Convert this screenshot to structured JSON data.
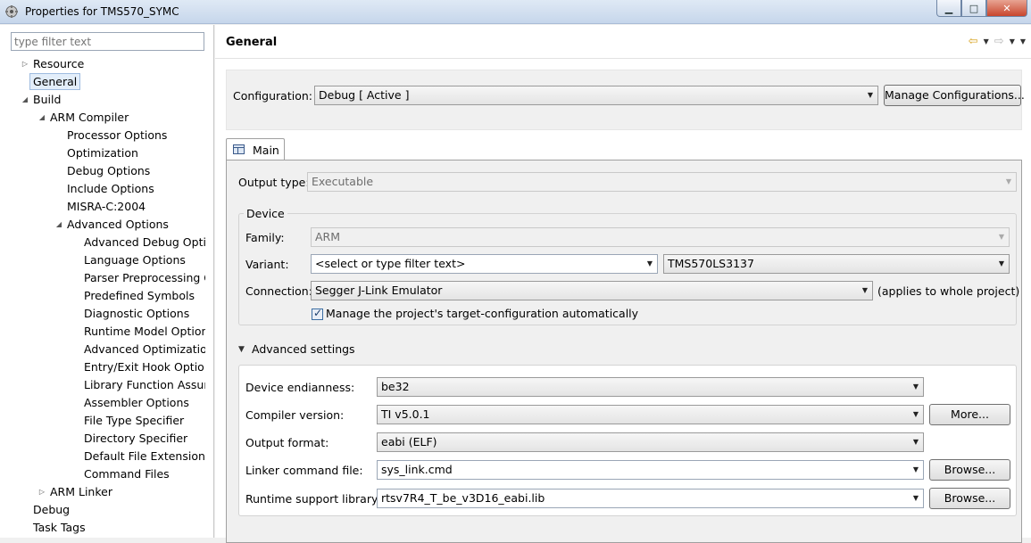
{
  "window": {
    "title": "Properties for TMS570_SYMC",
    "minimize": "▁",
    "maximize": "□",
    "close": "✕"
  },
  "sidebar": {
    "filter_placeholder": "type filter text",
    "items": [
      {
        "label": "Resource",
        "toggle": "▷"
      },
      {
        "label": "General",
        "toggle": ""
      },
      {
        "label": "Build",
        "toggle": "◢"
      },
      {
        "label": "ARM Compiler",
        "toggle": "◢"
      },
      {
        "label": "Processor Options",
        "toggle": ""
      },
      {
        "label": "Optimization",
        "toggle": ""
      },
      {
        "label": "Debug Options",
        "toggle": ""
      },
      {
        "label": "Include Options",
        "toggle": ""
      },
      {
        "label": "MISRA-C:2004",
        "toggle": ""
      },
      {
        "label": "Advanced Options",
        "toggle": "◢"
      },
      {
        "label": "Advanced Debug Options",
        "toggle": ""
      },
      {
        "label": "Language Options",
        "toggle": ""
      },
      {
        "label": "Parser Preprocessing Options",
        "toggle": ""
      },
      {
        "label": "Predefined Symbols",
        "toggle": ""
      },
      {
        "label": "Diagnostic Options",
        "toggle": ""
      },
      {
        "label": "Runtime Model Options",
        "toggle": ""
      },
      {
        "label": "Advanced Optimizations",
        "toggle": ""
      },
      {
        "label": "Entry/Exit Hook Options",
        "toggle": ""
      },
      {
        "label": "Library Function Assumptions",
        "toggle": ""
      },
      {
        "label": "Assembler Options",
        "toggle": ""
      },
      {
        "label": "File Type Specifier",
        "toggle": ""
      },
      {
        "label": "Directory Specifier",
        "toggle": ""
      },
      {
        "label": "Default File Extensions",
        "toggle": ""
      },
      {
        "label": "Command Files",
        "toggle": ""
      },
      {
        "label": "ARM Linker",
        "toggle": "▷"
      },
      {
        "label": "Debug",
        "toggle": ""
      },
      {
        "label": "Task Tags",
        "toggle": ""
      }
    ]
  },
  "header": {
    "title": "General",
    "back": "⇦",
    "forward": "⇨",
    "dropdown": "▼"
  },
  "config": {
    "label": "Configuration:",
    "value": "Debug  [ Active ]",
    "manage_button": "Manage Configurations..."
  },
  "tab": {
    "label": "Main"
  },
  "main": {
    "output_type_label": "Output type:",
    "output_type_value": "Executable",
    "device_group": "Device",
    "family_label": "Family:",
    "family_value": "ARM",
    "variant_label": "Variant:",
    "variant_filter": "<select or type filter text>",
    "variant_value": "TMS570LS3137",
    "connection_label": "Connection:",
    "connection_value": "Segger J-Link Emulator",
    "connection_note": "(applies to whole project)",
    "manage_target_label": "Manage the project's target-configuration automatically",
    "advanced_title": "Advanced settings",
    "endianness_label": "Device endianness:",
    "endianness_value": "be32",
    "compiler_label": "Compiler version:",
    "compiler_value": "TI v5.0.1",
    "more_button": "More...",
    "output_format_label": "Output format:",
    "output_format_value": "eabi (ELF)",
    "linker_label": "Linker command file:",
    "linker_value": "sys_link.cmd",
    "browse_button": "Browse...",
    "runtime_label": "Runtime support library:",
    "runtime_value": "rtsv7R4_T_be_v3D16_eabi.lib",
    "browse_button2": "Browse..."
  },
  "icons": {
    "dropdown_arrow": "▼",
    "expanded": "◢",
    "collapsed": "▷"
  }
}
